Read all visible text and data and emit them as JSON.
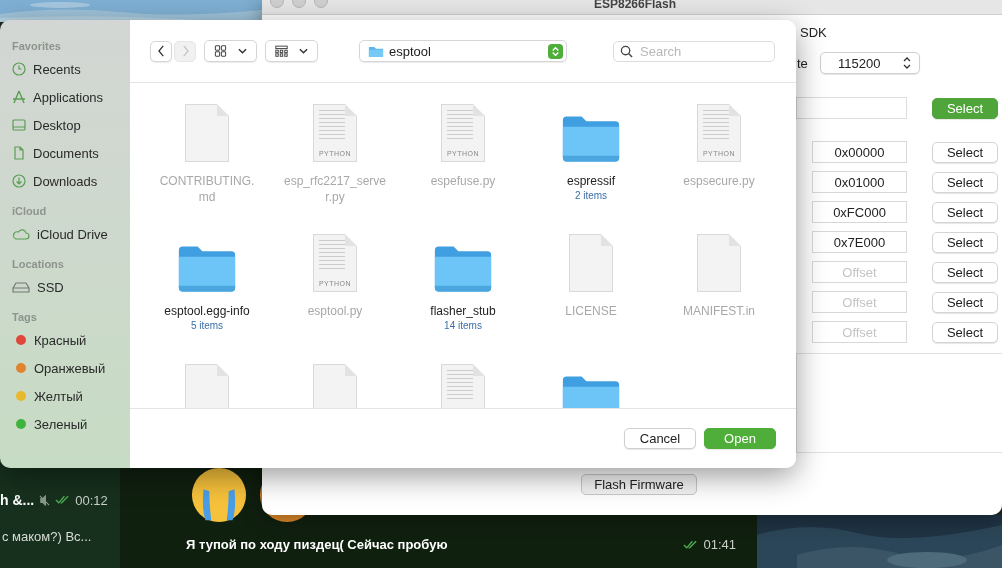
{
  "flasher": {
    "title": "ESP8266Flash",
    "sdk_label": "SDK",
    "baud_label": "te",
    "baud": "115200",
    "file_button": "Select",
    "offsets": [
      {
        "value": "0x00000",
        "button": "Select"
      },
      {
        "value": "0x01000",
        "button": "Select"
      },
      {
        "value": "0xFC000",
        "button": "Select"
      },
      {
        "value": "0x7E000",
        "button": "Select"
      },
      {
        "placeholder": "Offset",
        "button": "Select"
      },
      {
        "placeholder": "Offset",
        "button": "Select"
      },
      {
        "placeholder": "Offset",
        "button": "Select"
      }
    ],
    "flash_button": "Flash Firmware"
  },
  "chat": {
    "chats": [
      {
        "title": "h &...",
        "time": "00:12",
        "preview": "с маком?) Вс..."
      }
    ],
    "message": {
      "text": "Я тупой по ходу пиздец( Сейчас пробую",
      "time": "01:41"
    }
  },
  "dialog": {
    "sidebar": [
      {
        "heading": "Favorites",
        "items": [
          {
            "label": "Recents",
            "kind": "clock"
          },
          {
            "label": "Applications",
            "kind": "apps"
          },
          {
            "label": "Desktop",
            "kind": "desktop"
          },
          {
            "label": "Documents",
            "kind": "doc"
          },
          {
            "label": "Downloads",
            "kind": "download"
          }
        ]
      },
      {
        "heading": "iCloud",
        "items": [
          {
            "label": "iCloud Drive",
            "kind": "cloud"
          }
        ]
      },
      {
        "heading": "Locations",
        "items": [
          {
            "label": "SSD",
            "kind": "disk"
          }
        ]
      },
      {
        "heading": "Tags",
        "items": [
          {
            "label": "Красный",
            "color": "#e0463a"
          },
          {
            "label": "Оранжевый",
            "color": "#e2832f"
          },
          {
            "label": "Желтый",
            "color": "#e8b92d"
          },
          {
            "label": "Зеленый",
            "color": "#3fb43a"
          }
        ]
      }
    ],
    "nav": [
      {
        "kind": "back",
        "disabled": false
      },
      {
        "kind": "forward",
        "disabled": true
      }
    ],
    "location": "esptool",
    "search_placeholder": "Search",
    "files": [
      {
        "kind": "doc",
        "name": "CONTRIBUTING.md",
        "disabled": true
      },
      {
        "kind": "python",
        "badge": "PYTHON",
        "name": "esp_rfc2217_server.py",
        "disabled": true
      },
      {
        "kind": "python",
        "badge": "PYTHON",
        "name": "espefuse.py",
        "disabled": true
      },
      {
        "kind": "folder",
        "name": "espressif",
        "count": "2 items",
        "disabled": false
      },
      {
        "kind": "python",
        "badge": "PYTHON",
        "name": "espsecure.py",
        "disabled": true
      },
      {
        "kind": "folder",
        "name": "esptool.egg-info",
        "count": "5 items",
        "disabled": false
      },
      {
        "kind": "python",
        "badge": "PYTHON",
        "name": "esptool.py",
        "disabled": true
      },
      {
        "kind": "folder",
        "name": "flasher_stub",
        "count": "14 items",
        "disabled": false
      },
      {
        "kind": "doc",
        "name": "LICENSE",
        "disabled": true
      },
      {
        "kind": "doc",
        "name": "MANIFEST.in",
        "disabled": true
      },
      {
        "kind": "doc"
      },
      {
        "kind": "doc"
      },
      {
        "kind": "python"
      },
      {
        "kind": "folder"
      }
    ],
    "buttons": [
      {
        "label": "Cancel",
        "primary": false
      },
      {
        "label": "Open",
        "primary": true
      }
    ]
  }
}
